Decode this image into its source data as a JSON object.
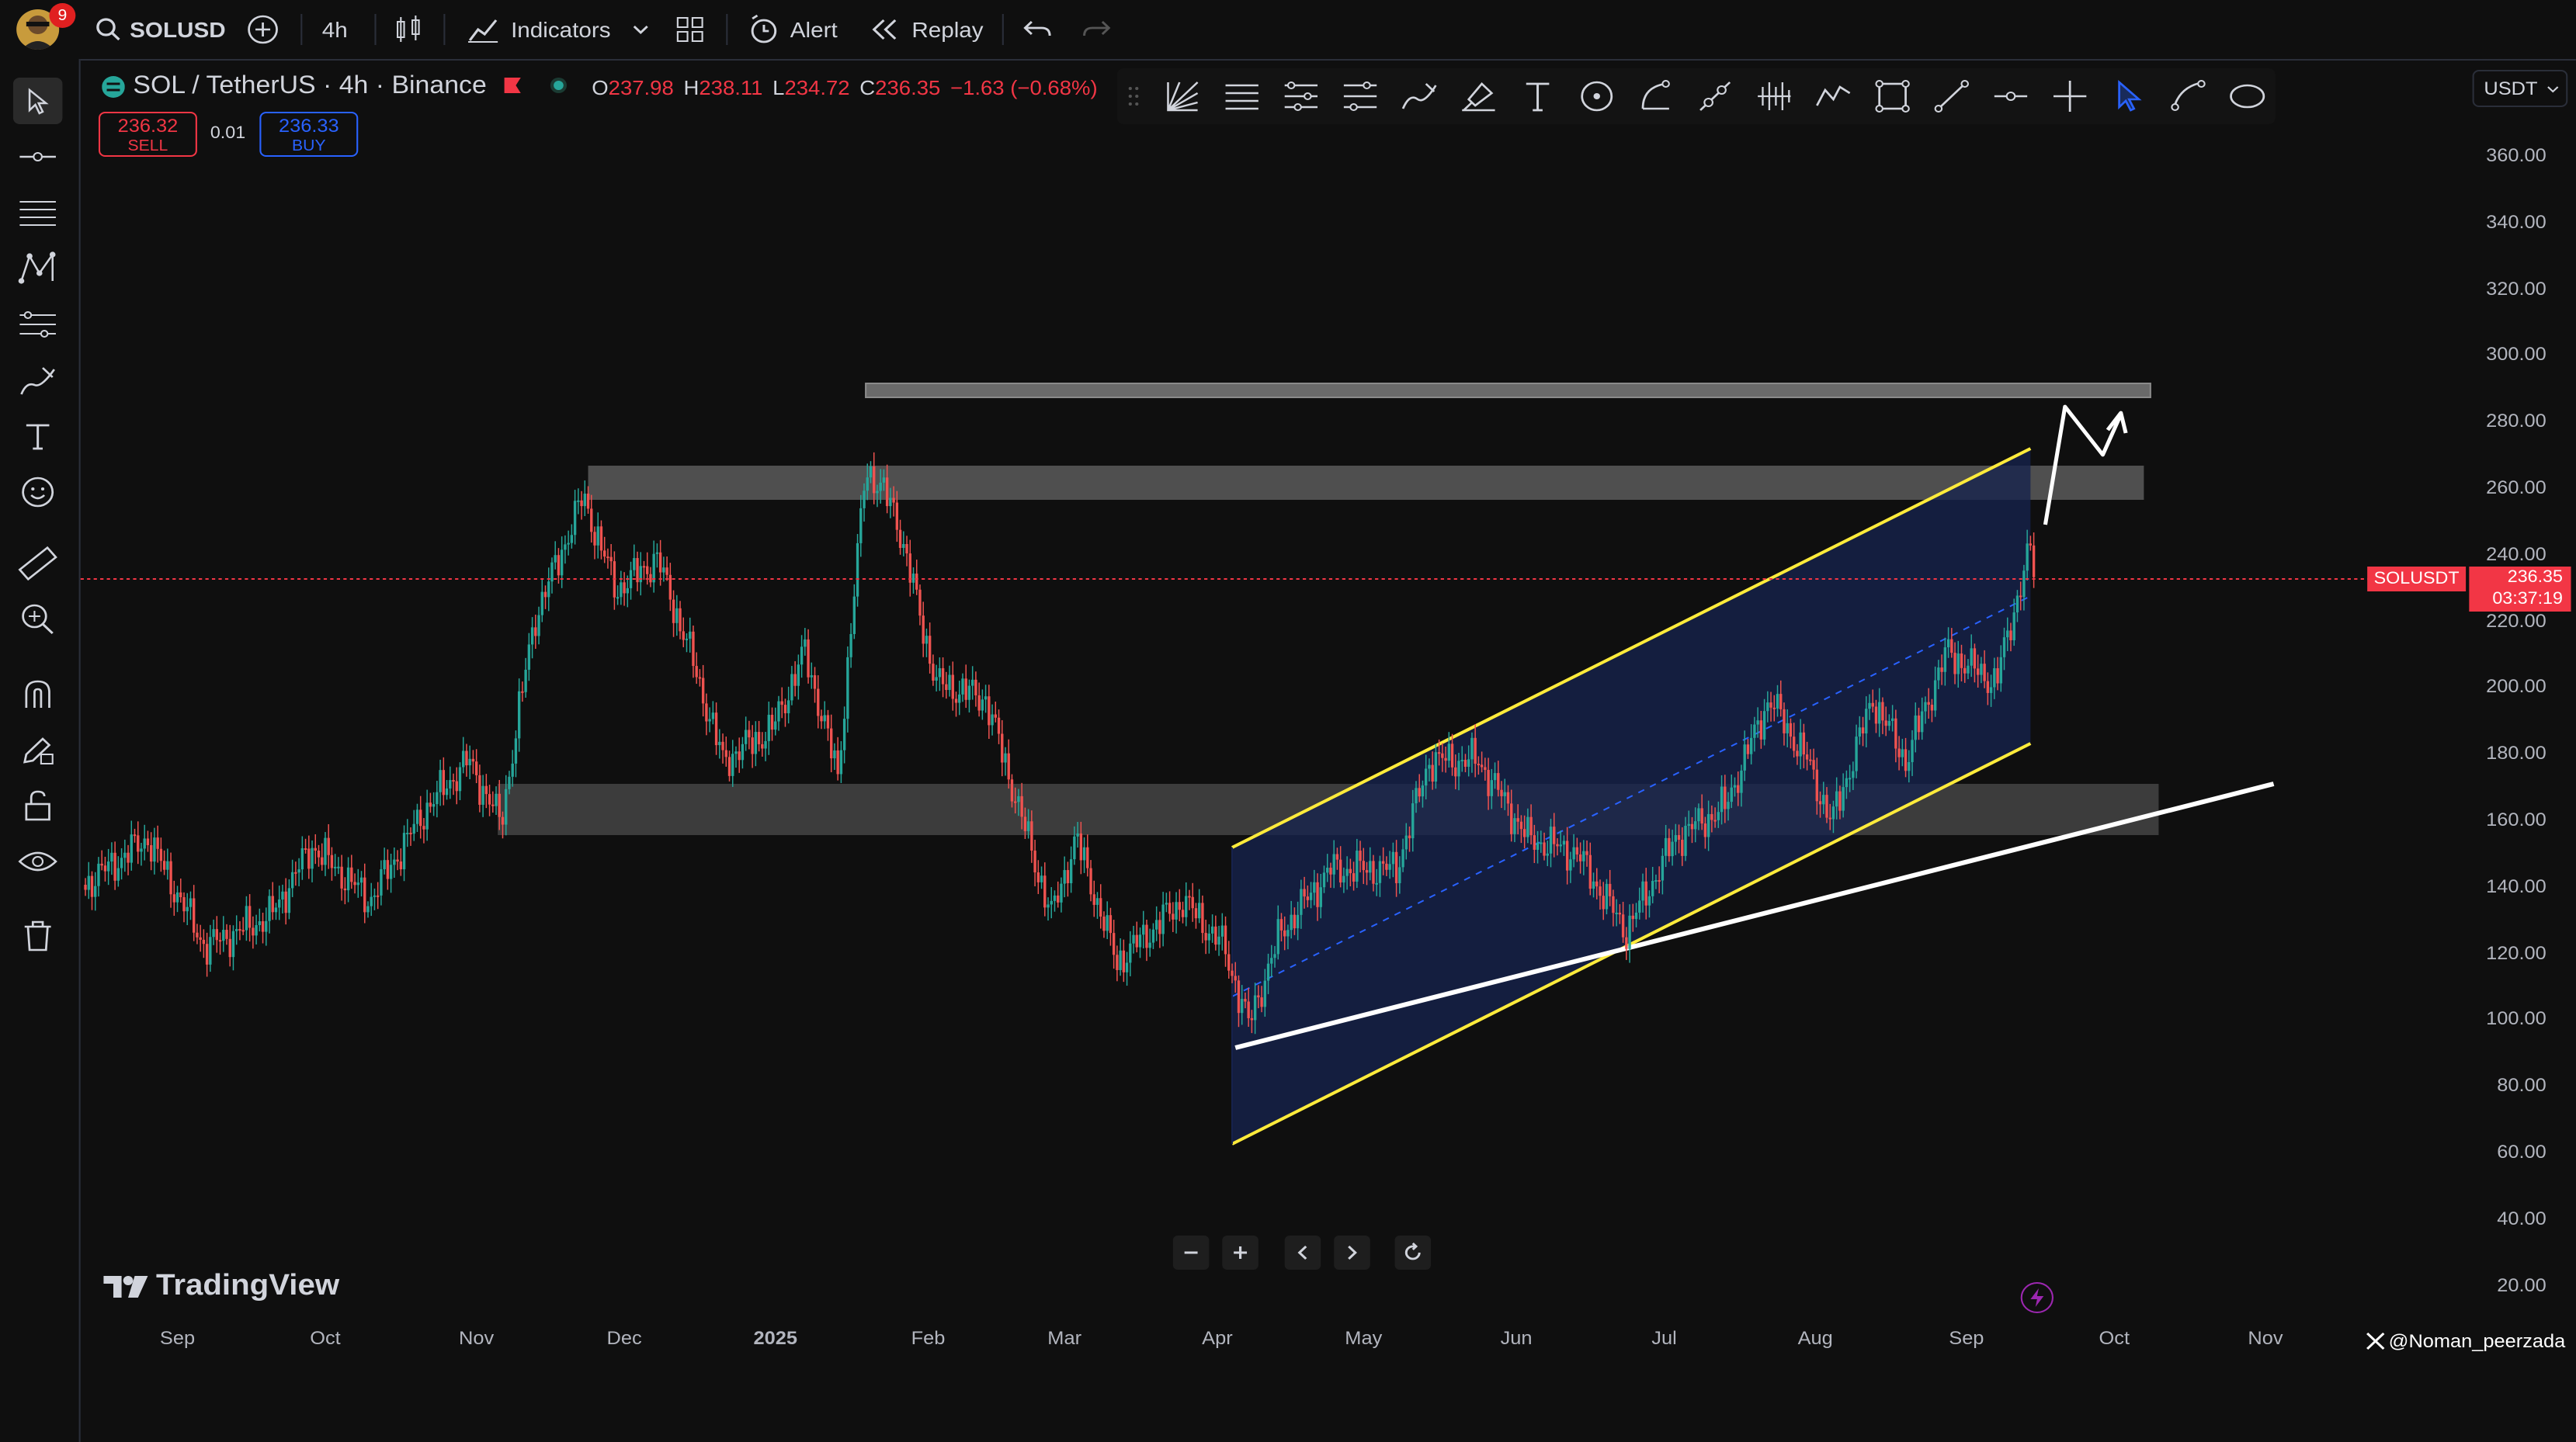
{
  "topbar": {
    "notification_count": "9",
    "symbol": "SOLUSD",
    "interval": "4h",
    "indicators_label": "Indicators",
    "alert_label": "Alert",
    "replay_label": "Replay"
  },
  "legend": {
    "title": "SOL / TetherUS · 4h · Binance",
    "open_label": "O",
    "open": "237.98",
    "high_label": "H",
    "high": "238.11",
    "low_label": "L",
    "low": "234.72",
    "close_label": "C",
    "close": "236.35",
    "change": "−1.63 (−0.68%)",
    "sell_price": "236.32",
    "sell_label": "SELL",
    "spread": "0.01",
    "buy_price": "236.33",
    "buy_label": "BUY"
  },
  "currency_select": "USDT",
  "price_axis": [
    "360.00",
    "340.00",
    "320.00",
    "300.00",
    "280.00",
    "260.00",
    "240.00",
    "220.00",
    "200.00",
    "180.00",
    "160.00",
    "140.00",
    "120.00",
    "100.00",
    "80.00",
    "60.00",
    "40.00",
    "20.00"
  ],
  "time_axis": [
    "Sep",
    "Oct",
    "Nov",
    "Dec",
    "2025",
    "Feb",
    "Mar",
    "Apr",
    "May",
    "Jun",
    "Jul",
    "Aug",
    "Sep",
    "Oct",
    "Nov"
  ],
  "symbol_tag": "SOLUSDT",
  "last_price": "236.35",
  "countdown": "03:37:19",
  "branding": "TradingView",
  "watermark": "@Noman_peerzada",
  "colors": {
    "up": "#26a69a",
    "down": "#ef5350",
    "channel": "#ffeb3b",
    "accent": "#2962ff",
    "tag": "#f23645"
  }
}
